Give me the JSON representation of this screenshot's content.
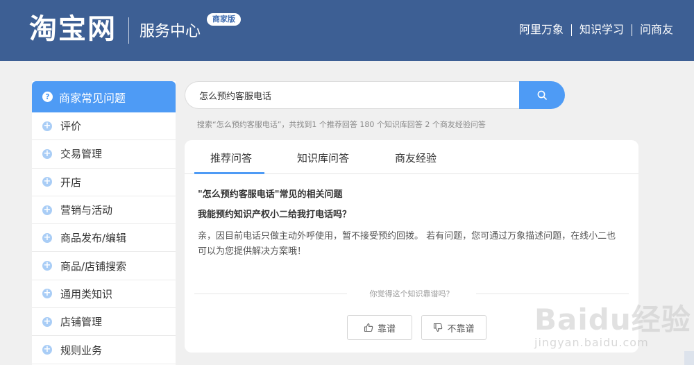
{
  "header": {
    "logo": "淘宝网",
    "service_title": "服务中心",
    "badge": "商家版",
    "nav": [
      "阿里万象",
      "知识学习",
      "问商友"
    ]
  },
  "sidebar": {
    "title": "商家常见问题",
    "items": [
      {
        "label": "评价"
      },
      {
        "label": "交易管理"
      },
      {
        "label": "开店"
      },
      {
        "label": "营销与活动"
      },
      {
        "label": "商品发布/编辑"
      },
      {
        "label": "商品/店铺搜索"
      },
      {
        "label": "通用类知识"
      },
      {
        "label": "店铺管理"
      },
      {
        "label": "规则业务"
      }
    ]
  },
  "search": {
    "value": "怎么预约客服电话",
    "summary": "搜索“怎么预约客服电话”，共找到1 个推荐回答 180 个知识库回答 2 个商友经验问答"
  },
  "tabs": [
    {
      "label": "推荐问答",
      "active": true
    },
    {
      "label": "知识库问答",
      "active": false
    },
    {
      "label": "商友经验",
      "active": false
    }
  ],
  "content": {
    "related_title": "\"怎么预约客服电话\"常见的相关问题",
    "question": "我能预约知识产权小二给我打电话吗？",
    "answer": "亲，因目前电话只做主动外呼使用，暂不接受预约回拨。 若有问题，您可通过万象描述问题，在线小二也可以为您提供解决方案哦！"
  },
  "feedback": {
    "question": "你觉得这个知识靠谱吗？",
    "helpful": "靠谱",
    "not_helpful": "不靠谱"
  },
  "watermark": {
    "logo": "Baidu经验",
    "url": "jingyan.baidu.com"
  },
  "colors": {
    "header_bg": "#3d5f94",
    "accent": "#4e9bf5",
    "page_bg": "#f0f0f0"
  }
}
